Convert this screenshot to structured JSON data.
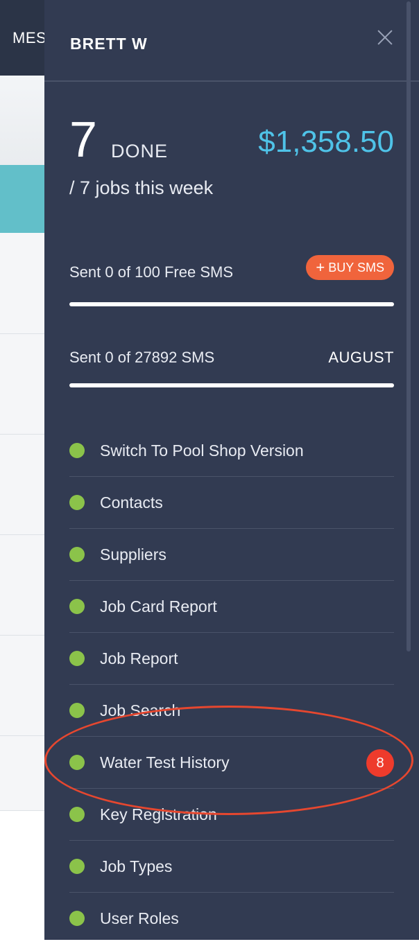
{
  "background": {
    "header_label": "MESSAGES"
  },
  "drawer": {
    "title": "BRETT W",
    "stats": {
      "done_count": "7",
      "done_label": "DONE",
      "jobs_week": "/ 7 jobs this week",
      "earnings": "$1,358.50"
    },
    "sms": {
      "free_label": "Sent 0 of 100 Free SMS",
      "free_used_fraction": 0,
      "buy_label": "BUY SMS",
      "total_label": "Sent 0 of 27892 SMS",
      "total_used_fraction": 0,
      "month": "AUGUST"
    },
    "menu": [
      {
        "label": "Switch To Pool Shop Version"
      },
      {
        "label": "Contacts"
      },
      {
        "label": "Suppliers"
      },
      {
        "label": "Job Card Report"
      },
      {
        "label": "Job Report"
      },
      {
        "label": "Job Search"
      },
      {
        "label": "Water Test History",
        "badge": "8"
      },
      {
        "label": "Key Registration"
      },
      {
        "label": "Job Types"
      },
      {
        "label": "User Roles"
      }
    ]
  },
  "colors": {
    "drawer_bg": "#323b52",
    "accent_blue": "#4fc3e8",
    "buy_orange": "#f0643c",
    "status_green": "#8bc34a",
    "badge_red": "#ee3b2c",
    "annotation_red": "#e6472f"
  },
  "icons": {
    "close": "close-icon",
    "plus": "plus-icon",
    "status_dot": "status-dot-icon"
  }
}
